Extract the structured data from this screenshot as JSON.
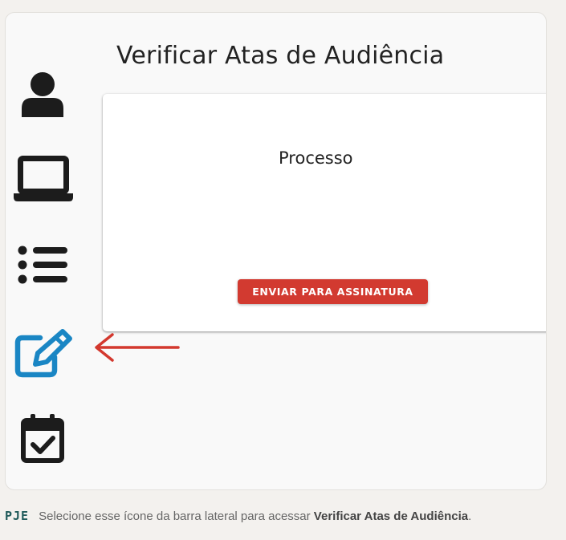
{
  "main": {
    "title": "Verificar Atas de Audiência",
    "card": {
      "title": "Processo",
      "button_label": "ENVIAR PARA ASSINATURA"
    }
  },
  "sidebar": {
    "items": [
      {
        "icon": "user-icon",
        "active": false
      },
      {
        "icon": "laptop-icon",
        "active": false
      },
      {
        "icon": "list-icon",
        "active": false
      },
      {
        "icon": "edit-icon",
        "active": true
      },
      {
        "icon": "calendar-check-icon",
        "active": false
      }
    ]
  },
  "caption": {
    "brand": "PJE",
    "text": "Selecione esse ícone da barra lateral para acessar ",
    "highlight": "Verificar Atas de Audiência",
    "end": "."
  },
  "colors": {
    "active_icon": "#1a86c4",
    "icon": "#1c1c1c",
    "button": "#d23a30",
    "arrow": "#d3382e",
    "brand": "#1f5a5a"
  }
}
